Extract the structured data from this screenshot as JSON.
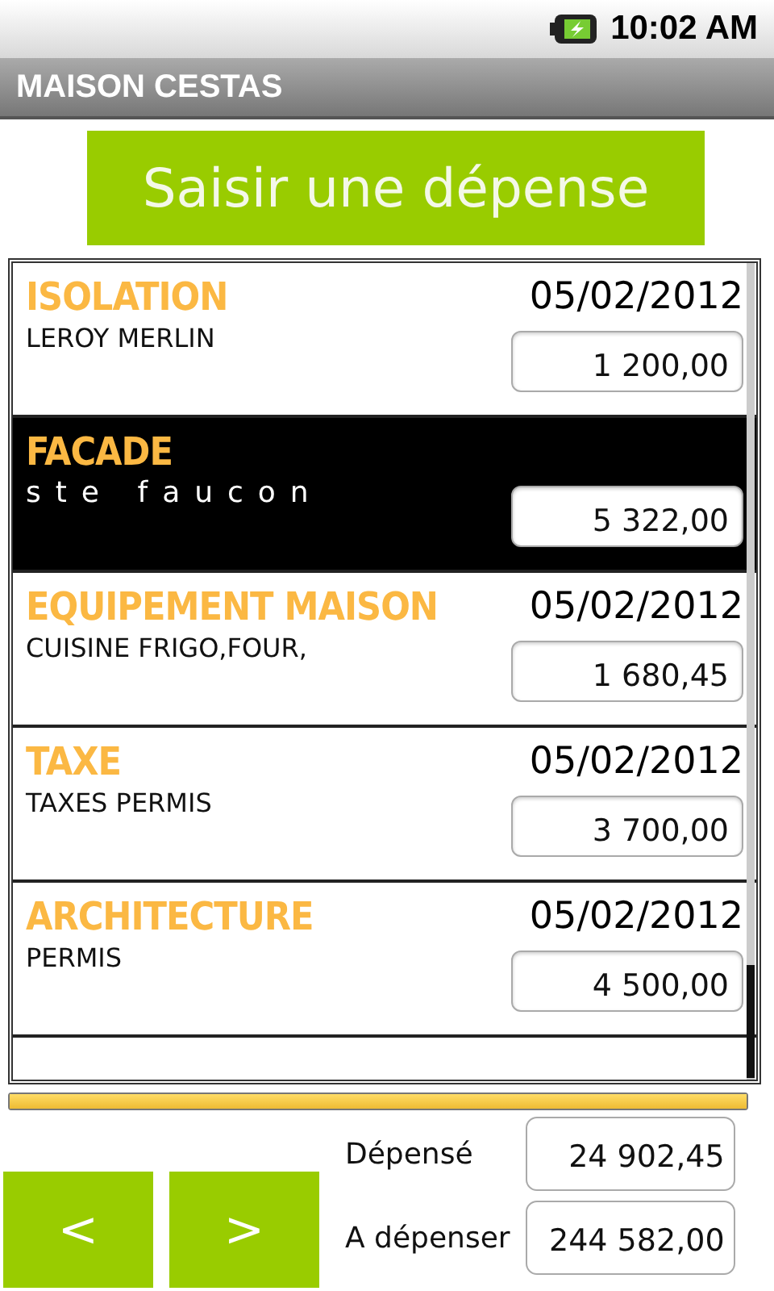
{
  "status_bar": {
    "time": "10:02 AM"
  },
  "window": {
    "title": "MAISON CESTAS"
  },
  "add_button": "Saisir une dépense",
  "expenses": [
    {
      "category": "ISOLATION",
      "description": "LEROY MERLIN",
      "date": "05/02/2012",
      "amount": "1 200,00",
      "selected": false
    },
    {
      "category": "FACADE",
      "description": "ste faucon",
      "amount": "5 322,00",
      "selected": true
    },
    {
      "category": "EQUIPEMENT MAISON",
      "description": "CUISINE FRIGO,FOUR,",
      "date": "05/02/2012",
      "amount": "1 680,45",
      "selected": false
    },
    {
      "category": "TAXE",
      "description": "TAXES PERMIS",
      "date": "05/02/2012",
      "amount": "3 700,00",
      "selected": false
    },
    {
      "category": "ARCHITECTURE",
      "description": "PERMIS",
      "date": "05/02/2012",
      "amount": "4 500,00",
      "selected": false
    }
  ],
  "budget": {
    "level": 1
  },
  "nav": {
    "prev": "<",
    "next": ">"
  },
  "totals": [
    {
      "label": "Dépensé",
      "value": "24 902,45"
    },
    {
      "label": "A dépenser",
      "value": "244 582,00"
    }
  ]
}
